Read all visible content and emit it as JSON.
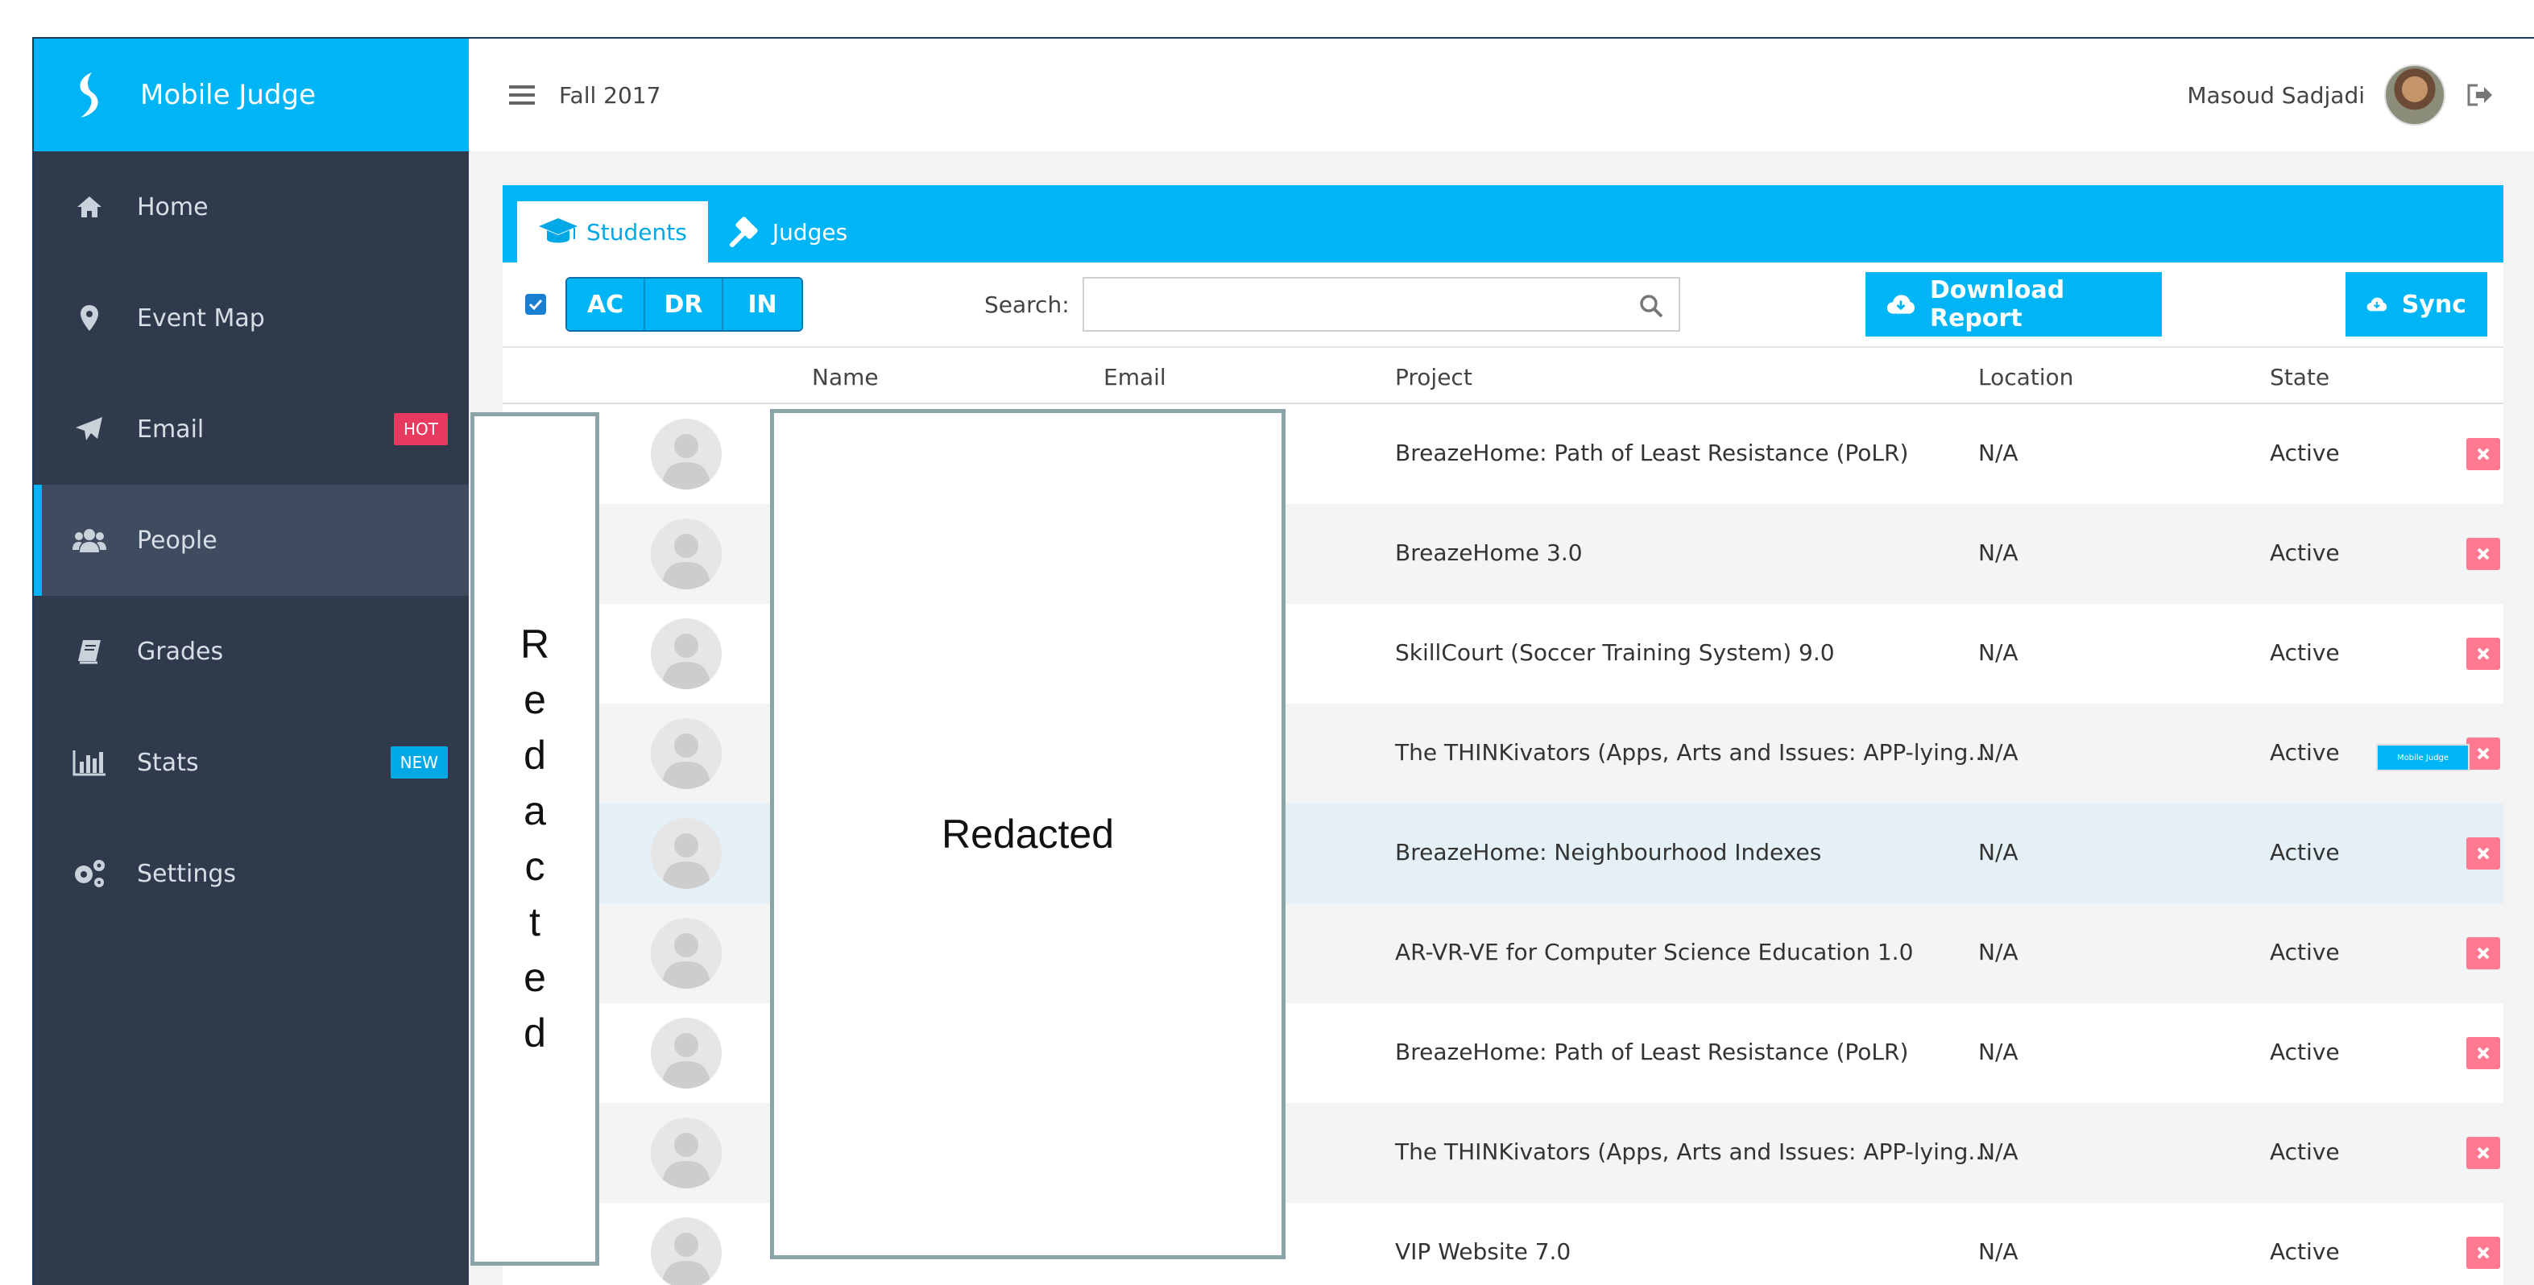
{
  "app": {
    "title": "Mobile Judge"
  },
  "sidebar": {
    "items": [
      {
        "label": "Home",
        "icon": "home-icon"
      },
      {
        "label": "Event Map",
        "icon": "map-marker-icon"
      },
      {
        "label": "Email",
        "icon": "paper-plane-icon",
        "badge": "HOT"
      },
      {
        "label": "People",
        "icon": "users-icon",
        "active": true
      },
      {
        "label": "Grades",
        "icon": "book-icon"
      },
      {
        "label": "Stats",
        "icon": "bar-chart-icon",
        "badge": "NEW"
      },
      {
        "label": "Settings",
        "icon": "gears-icon"
      }
    ]
  },
  "topbar": {
    "term": "Fall 2017",
    "user_name": "Masoud Sadjadi"
  },
  "tabs": [
    {
      "label": "Students",
      "icon": "graduation-cap-icon",
      "active": true
    },
    {
      "label": "Judges",
      "icon": "gavel-icon"
    }
  ],
  "toolbar": {
    "filters": [
      "AC",
      "DR",
      "IN"
    ],
    "search_label": "Search:",
    "search_value": "",
    "download_label": "Download Report",
    "sync_label": "Sync"
  },
  "table": {
    "headers": {
      "name": "Name",
      "email": "Email",
      "project": "Project",
      "location": "Location",
      "state": "State"
    },
    "rows": [
      {
        "project": "BreazeHome: Path of Least Resistance (PoLR)",
        "location": "N/A",
        "state": "Active"
      },
      {
        "project": "BreazeHome 3.0",
        "location": "N/A",
        "state": "Active"
      },
      {
        "project": "SkillCourt (Soccer Training System) 9.0",
        "location": "N/A",
        "state": "Active"
      },
      {
        "project": "The THINKivators (Apps, Arts and Issues: APP-lying...",
        "location": "N/A",
        "state": "Active"
      },
      {
        "project": "BreazeHome: Neighbourhood Indexes",
        "location": "N/A",
        "state": "Active"
      },
      {
        "project": "AR-VR-VE for Computer Science Education 1.0",
        "location": "N/A",
        "state": "Active"
      },
      {
        "project": "BreazeHome: Path of Least Resistance (PoLR)",
        "location": "N/A",
        "state": "Active"
      },
      {
        "project": "The THINKivators (Apps, Arts and Issues: APP-lying...",
        "location": "N/A",
        "state": "Active"
      },
      {
        "project": "VIP Website 7.0",
        "location": "N/A",
        "state": "Active"
      }
    ]
  },
  "redacted": {
    "label": "Redacted"
  },
  "tooltip": {
    "label": "Mobile Judge"
  },
  "colors": {
    "accent": "#00b5f6",
    "sidebar": "#2f3b4d",
    "hot": "#e83a5e",
    "delete": "#ff7a90"
  }
}
